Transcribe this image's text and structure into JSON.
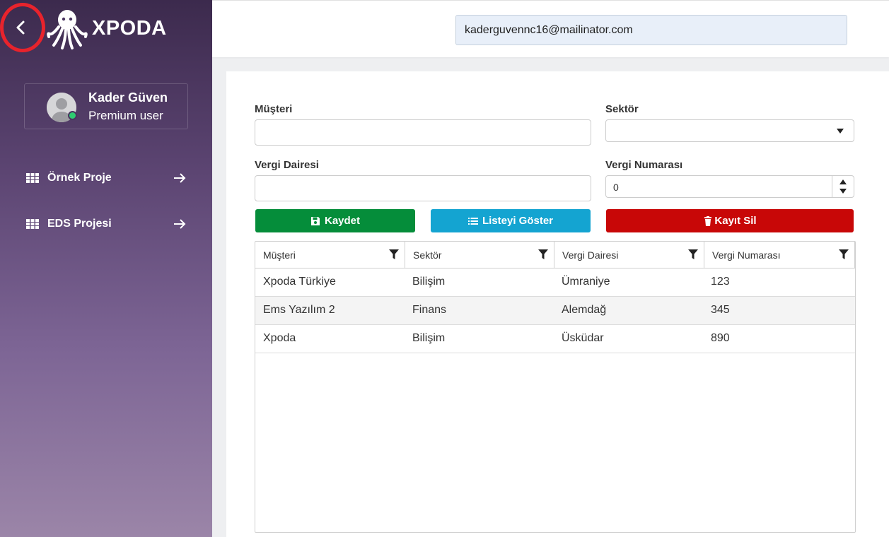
{
  "app": {
    "name": "XPODA"
  },
  "colors": {
    "accent_green": "#058d3a",
    "accent_cyan": "#14a4d1",
    "accent_red": "#c80707",
    "online": "#2ecc71"
  },
  "user": {
    "name": "Kader Güven",
    "role": "Premium user",
    "status": "online"
  },
  "sidebar": {
    "items": [
      {
        "label": "Örnek Proje",
        "icon": "grid-icon"
      },
      {
        "label": "EDS Projesi",
        "icon": "grid-icon"
      }
    ]
  },
  "header": {
    "email": "kaderguvennc16@mailinator.com"
  },
  "form": {
    "musteri": {
      "label": "Müşteri",
      "value": ""
    },
    "sektor": {
      "label": "Sektör",
      "value": ""
    },
    "vergi_dairesi": {
      "label": "Vergi Dairesi",
      "value": ""
    },
    "vergi_numarasi": {
      "label": "Vergi Numarası",
      "value": "0"
    }
  },
  "buttons": {
    "save": "Kaydet",
    "list": "Listeyi Göster",
    "delete": "Kayıt Sil"
  },
  "table": {
    "columns": [
      "Müşteri",
      "Sektör",
      "Vergi Dairesi",
      "Vergi Numarası"
    ],
    "rows": [
      [
        "Xpoda Türkiye",
        "Bilişim",
        "Ümraniye",
        "123"
      ],
      [
        "Ems Yazılım 2",
        "Finans",
        "Alemdağ",
        "345"
      ],
      [
        "Xpoda",
        "Bilişim",
        "Üsküdar",
        "890"
      ]
    ]
  }
}
